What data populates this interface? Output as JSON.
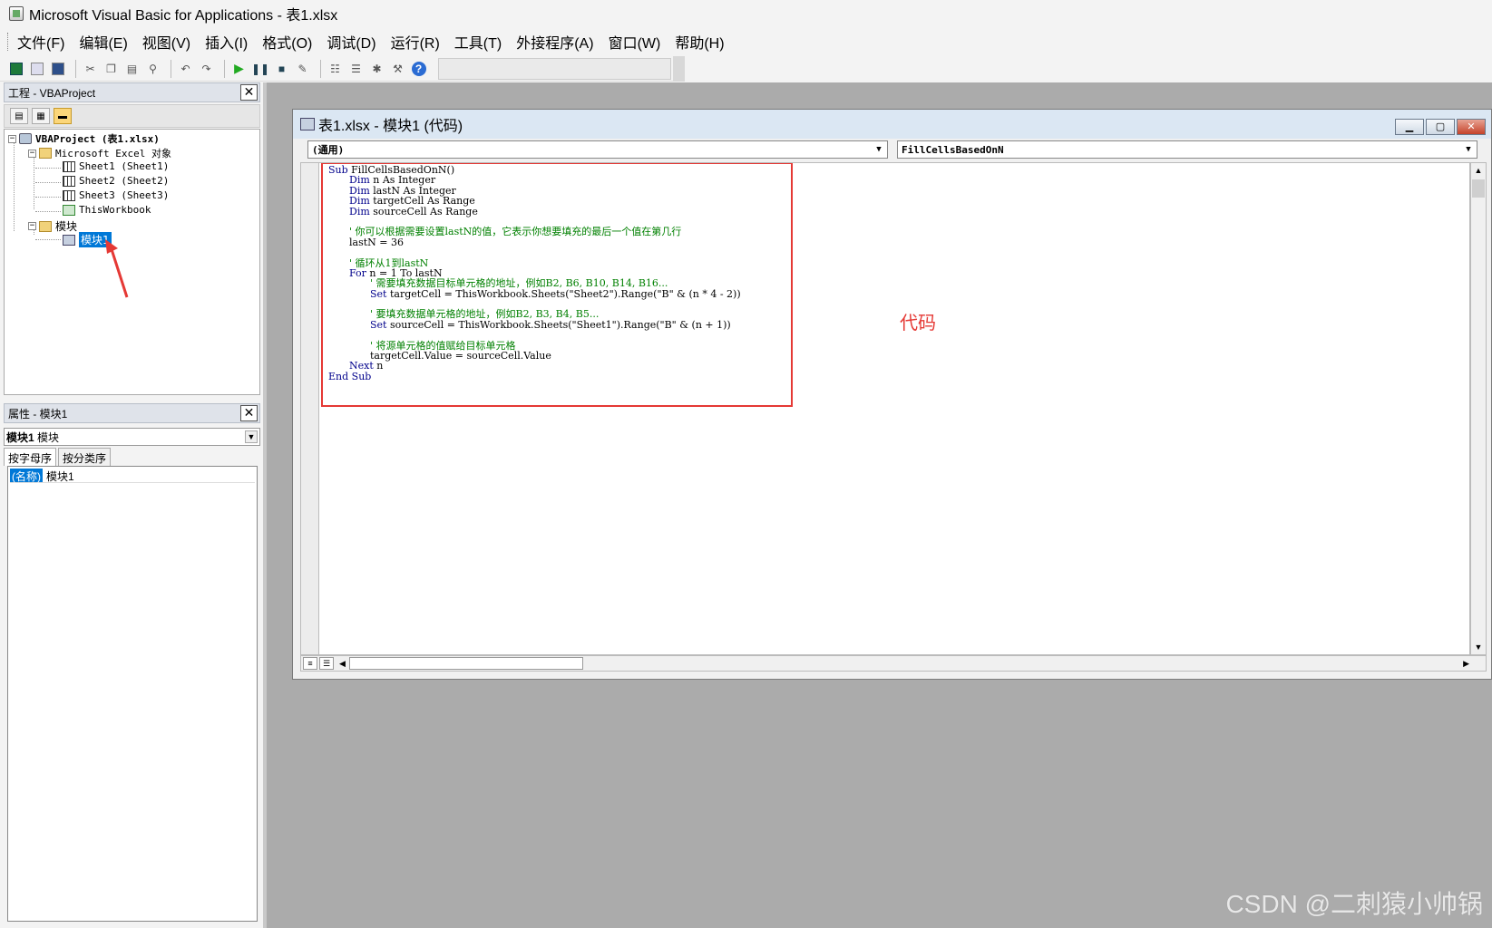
{
  "window": {
    "title": "Microsoft Visual Basic for Applications - 表1.xlsx"
  },
  "menu": [
    "文件(F)",
    "编辑(E)",
    "视图(V)",
    "插入(I)",
    "格式(O)",
    "调试(D)",
    "运行(R)",
    "工具(T)",
    "外接程序(A)",
    "窗口(W)",
    "帮助(H)"
  ],
  "toolbar": {
    "icons": [
      "excel-icon",
      "insert-form-icon",
      "save-icon",
      "cut-icon",
      "copy-icon",
      "paste-icon",
      "find-icon",
      "undo-icon",
      "redo-icon",
      "run-icon",
      "break-icon",
      "reset-icon",
      "design-mode-icon",
      "project-explorer-icon",
      "properties-icon",
      "object-browser-icon",
      "toolbox-icon",
      "help-icon"
    ]
  },
  "project": {
    "title": "工程 - VBAProject",
    "root": "VBAProject (表1.xlsx)",
    "excel_objects_label": "Microsoft Excel 对象",
    "sheets": [
      "Sheet1 (Sheet1)",
      "Sheet2 (Sheet2)",
      "Sheet3 (Sheet3)"
    ],
    "workbook": "ThisWorkbook",
    "modules_label": "模块",
    "module": "模块1"
  },
  "properties": {
    "title": "属性 - 模块1",
    "combo_name": "模块1",
    "combo_type": "模块",
    "tab_alpha": "按字母序",
    "tab_category": "按分类序",
    "row_key": "(名称)",
    "row_value": "模块1"
  },
  "code_window": {
    "title": "表1.xlsx - 模块1 (代码)",
    "object_combo": "(通用)",
    "proc_combo": "FillCellsBasedOnN",
    "annotation": "代码",
    "lines": [
      {
        "indent": 0,
        "kw": "Sub",
        "text": " FillCellsBasedOnN()",
        "type": "code"
      },
      {
        "indent": 1,
        "kw": "Dim",
        "text": " n As Integer",
        "type": "code"
      },
      {
        "indent": 1,
        "kw": "Dim",
        "text": " lastN As Integer",
        "type": "code"
      },
      {
        "indent": 1,
        "kw": "Dim",
        "text": " targetCell As Range",
        "type": "code"
      },
      {
        "indent": 1,
        "kw": "Dim",
        "text": " sourceCell As Range",
        "type": "code"
      },
      {
        "indent": 0,
        "kw": "",
        "text": "",
        "type": "blank"
      },
      {
        "indent": 1,
        "kw": "",
        "text": "' 你可以根据需要设置lastN的值，它表示你想要填充的最后一个值在第几行",
        "type": "comment"
      },
      {
        "indent": 1,
        "kw": "",
        "text": "lastN = 36",
        "type": "code"
      },
      {
        "indent": 0,
        "kw": "",
        "text": "",
        "type": "blank"
      },
      {
        "indent": 1,
        "kw": "",
        "text": "' 循环从1到lastN",
        "type": "comment"
      },
      {
        "indent": 1,
        "kw": "For",
        "text": " n = 1 To lastN",
        "type": "code"
      },
      {
        "indent": 2,
        "kw": "",
        "text": "' 需要填充数据目标单元格的地址，例如B2, B6, B10, B14, B16...",
        "type": "comment"
      },
      {
        "indent": 2,
        "kw": "Set",
        "text": " targetCell = ThisWorkbook.Sheets(\"Sheet2\").Range(\"B\" & (n * 4 - 2))",
        "type": "code"
      },
      {
        "indent": 0,
        "kw": "",
        "text": "",
        "type": "blank"
      },
      {
        "indent": 2,
        "kw": "",
        "text": "' 要填充数据单元格的地址，例如B2, B3, B4, B5...",
        "type": "comment"
      },
      {
        "indent": 2,
        "kw": "Set",
        "text": " sourceCell = ThisWorkbook.Sheets(\"Sheet1\").Range(\"B\" & (n + 1))",
        "type": "code"
      },
      {
        "indent": 0,
        "kw": "",
        "text": "",
        "type": "blank"
      },
      {
        "indent": 2,
        "kw": "",
        "text": "' 将源单元格的值赋给目标单元格",
        "type": "comment"
      },
      {
        "indent": 2,
        "kw": "",
        "text": "targetCell.Value = sourceCell.Value",
        "type": "code"
      },
      {
        "indent": 1,
        "kw": "Next",
        "text": " n",
        "type": "code"
      },
      {
        "indent": 0,
        "kw": "End Sub",
        "text": "",
        "type": "code"
      }
    ]
  },
  "watermark": "CSDN @二刺猿小帅锅",
  "colors": {
    "highlight": "#0078d7",
    "annotation": "#e53935",
    "keyword": "#00008b",
    "comment": "#008000"
  }
}
